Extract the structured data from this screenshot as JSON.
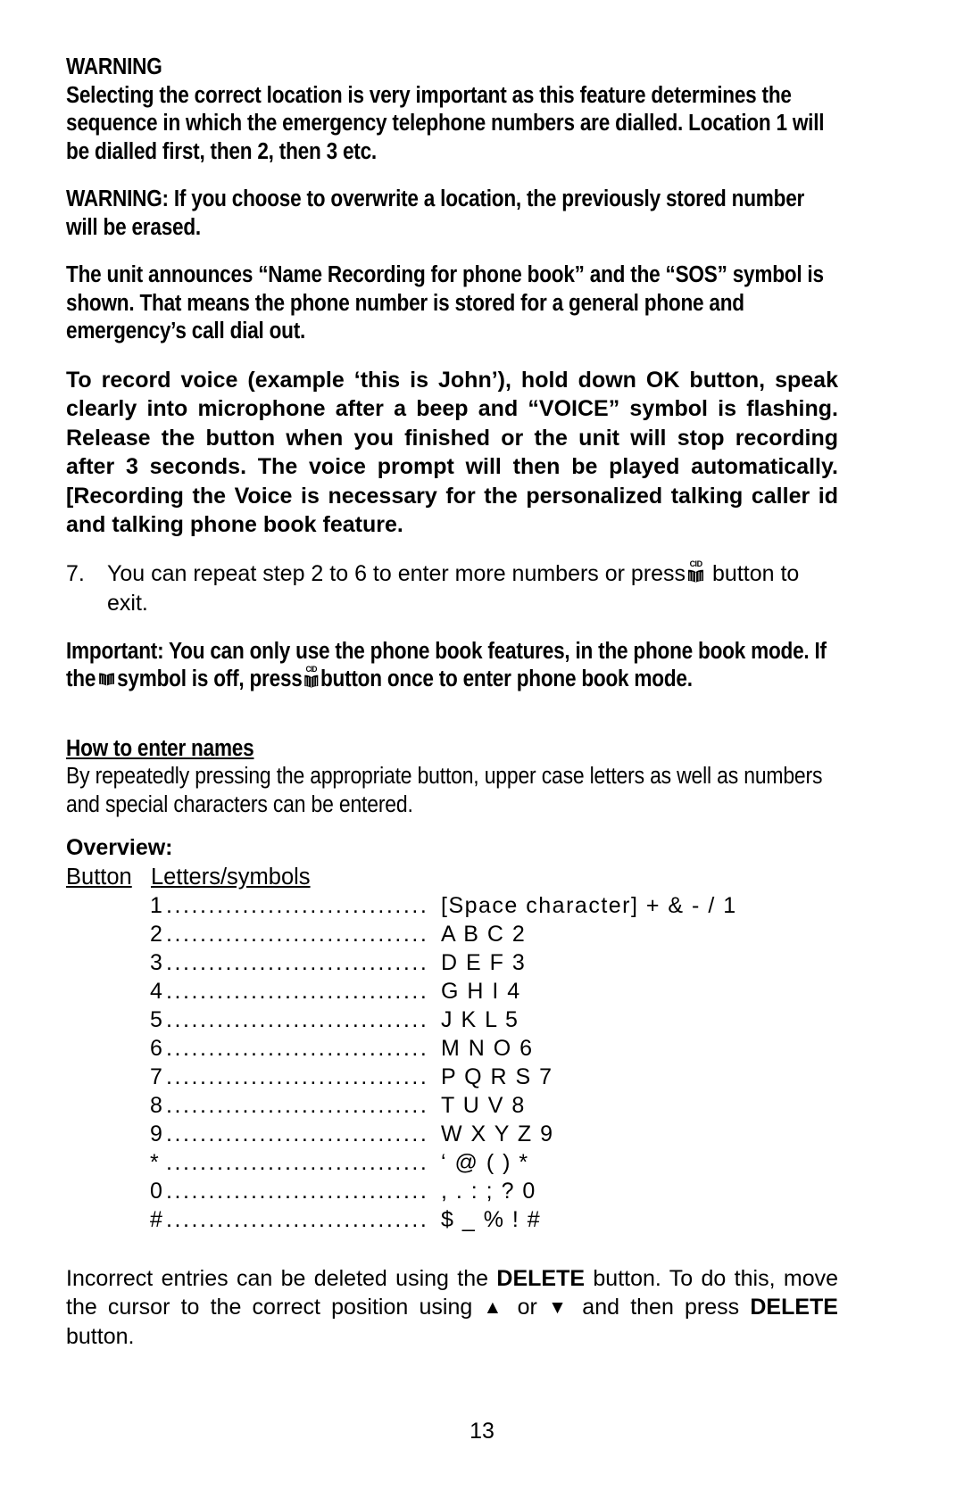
{
  "document": {
    "page_number": "13"
  },
  "sections": {
    "warning_heading": "WARNING",
    "warning_body": "Selecting the correct location is very important as this feature determines the sequence in which the emergency telephone numbers are dialled. Location 1 will be dialled first, then 2, then 3 etc.",
    "warning_overwrite": "WARNING: If you choose to overwrite a location, the previously stored number will be erased.",
    "announce_paragraph": "The unit announces “Name Recording for phone book” and the “SOS” symbol is shown. That means the phone number is stored for a general phone and emergency’s call dial out.",
    "record_voice_paragraph": "To record voice (example ‘this is John’), hold down OK button, speak clearly into microphone after a beep and “VOICE” symbol is flashing. Release the button when you finished or the unit will stop recording after 3 seconds. The voice prompt will then be played automatically. [Recording the Voice is necessary for the personalized talking caller id and talking phone book feature."
  },
  "step": {
    "number": "7.",
    "text_before_icon": "You can repeat step 2 to 6 to enter more numbers or press",
    "icon_name": "cid-phonebook-icon",
    "icon_label": "CID",
    "text_after_icon": "button to exit."
  },
  "important": {
    "lead": "Important: You can only use the phone book features, in the phone book mode. If the",
    "book_icon_name": "phonebook-icon",
    "mid": "symbol is off, press",
    "cid_icon_name": "cid-phonebook-icon",
    "cid_icon_label": "CID",
    "tail": "button once to enter phone book mode."
  },
  "how_to_enter_names": {
    "heading": "How to enter names",
    "body": "By repeatedly pressing the appropriate button, upper case letters as well as numbers and special characters can be entered."
  },
  "overview": {
    "heading": "Overview:",
    "col_button": "Button",
    "col_letters": "Letters/symbols",
    "dot_leader": "...................................................................",
    "rows": [
      {
        "button": "1",
        "letters": "[Space character] + & - / 1"
      },
      {
        "button": "2",
        "letters": "A B C 2"
      },
      {
        "button": "3",
        "letters": "D E F 3"
      },
      {
        "button": "4",
        "letters": "G H I 4"
      },
      {
        "button": "5",
        "letters": "J K L 5"
      },
      {
        "button": "6",
        "letters": "M N O 6"
      },
      {
        "button": "7",
        "letters": "P Q R S 7"
      },
      {
        "button": "8",
        "letters": "T U V 8"
      },
      {
        "button": "9",
        "letters": "W X Y Z 9"
      },
      {
        "button": "*",
        "letters": "‘ @ ( ) *"
      },
      {
        "button": "0",
        "letters": ", . : ; ? 0"
      },
      {
        "button": "#",
        "letters": "$ _ % ! #"
      }
    ]
  },
  "delete_note": {
    "part1": "Incorrect entries can be deleted using the",
    "delete_label_1": "DELETE",
    "part2": "button. To do this, move the cursor to the correct position using",
    "up_arrow": "▲",
    "or_text": "or",
    "down_arrow": "▼",
    "part3": "and then press",
    "delete_label_2": "DELETE",
    "part4": "button."
  }
}
